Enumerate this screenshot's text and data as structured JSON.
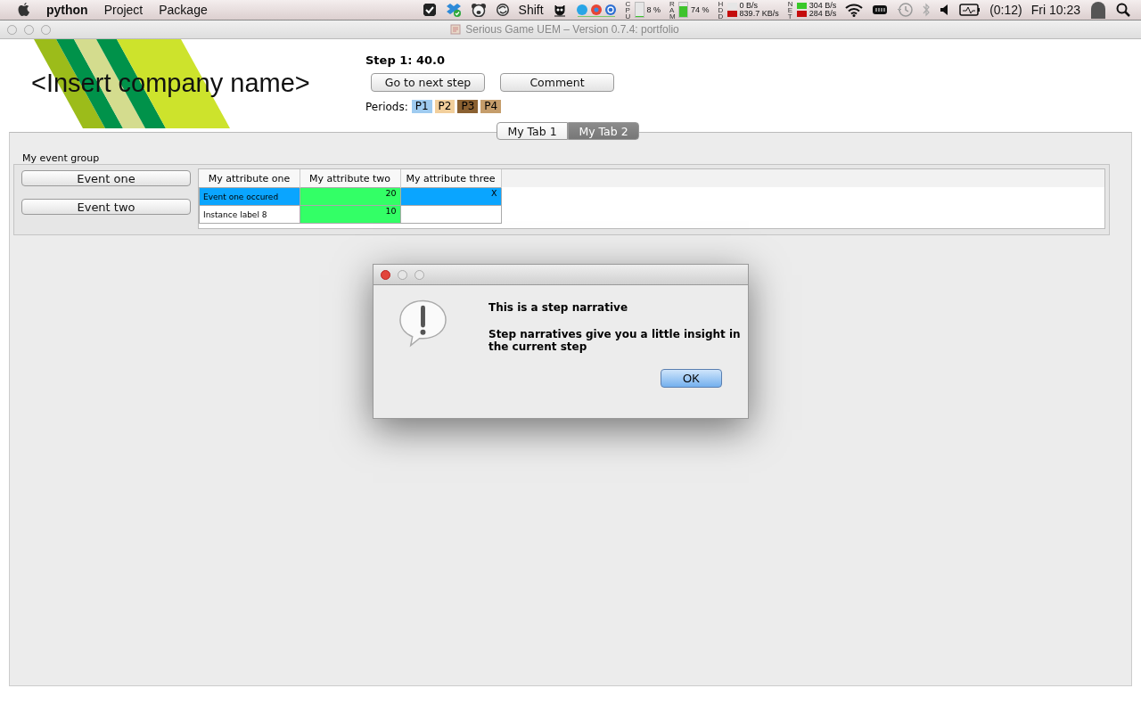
{
  "menu_bar": {
    "app": "python",
    "menus": [
      "Project",
      "Package"
    ],
    "status_items": [
      {
        "kind": "icon"
      },
      {
        "kind": "icon"
      },
      {
        "kind": "icon"
      },
      {
        "kind": "icon"
      },
      {
        "kind": "text",
        "text": "Shift"
      },
      {
        "kind": "icon"
      },
      {
        "kind": "icon"
      },
      {
        "kind": "meter",
        "label": "CPU",
        "reading": "8 %",
        "level": 0.08
      },
      {
        "kind": "meter",
        "label": "RAM",
        "reading": "74 %",
        "level": 0.74
      },
      {
        "kind": "rates",
        "label": "HDD",
        "top": "0 B/s",
        "bottom": "839.7 KB/s"
      },
      {
        "kind": "rates",
        "label": "NET",
        "top": "304 B/s",
        "bottom": "284 B/s"
      },
      {
        "kind": "icon"
      },
      {
        "kind": "icon"
      },
      {
        "kind": "icon"
      },
      {
        "kind": "icon"
      },
      {
        "kind": "icon"
      },
      {
        "kind": "battery",
        "text": "(0:12)"
      },
      {
        "kind": "text",
        "text": "Fri 10:23"
      },
      {
        "kind": "icon"
      },
      {
        "kind": "icon"
      }
    ]
  },
  "window": {
    "title": "Serious Game UEM – Version 0.7.4: portfolio"
  },
  "header": {
    "company": "<Insert company name>",
    "step": "Step 1: 40.0",
    "buttons": [
      "Go to next step",
      "Comment"
    ],
    "periods_label": "Periods:",
    "periods": [
      {
        "label": "P1",
        "color": "#9fcbf0"
      },
      {
        "label": "P2",
        "color": "#f2cf9c"
      },
      {
        "label": "P3",
        "color": "#8b6131"
      },
      {
        "label": "P4",
        "color": "#c59d6b"
      }
    ]
  },
  "tabs": [
    {
      "label": "My Tab 1",
      "selected": false
    },
    {
      "label": "My Tab 2",
      "selected": true
    }
  ],
  "event_group": {
    "title": "My event group",
    "buttons": [
      "Event one",
      "Event two"
    ],
    "table": {
      "columns": [
        "My attribute one",
        "My attribute two",
        "My attribute three"
      ],
      "rows": [
        [
          {
            "text": "Event one occured",
            "color": "#0aa5ff"
          },
          {
            "text": "20",
            "color": "#33ff66"
          },
          {
            "text": "X",
            "color": "#0aa5ff"
          }
        ],
        [
          {
            "text": "Instance label 8",
            "color": "#ffffff"
          },
          {
            "text": "10",
            "color": "#33ff66"
          },
          {
            "text": "",
            "color": "#ffffff"
          }
        ]
      ]
    }
  },
  "dialog": {
    "heading": "This is a step narrative",
    "message": "Step narratives give you a little insight in the current step",
    "button": "OK"
  }
}
